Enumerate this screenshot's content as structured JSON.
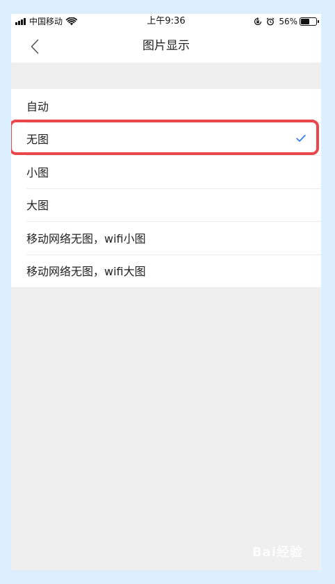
{
  "status_bar": {
    "carrier": "中国移动",
    "time": "上午9:36",
    "battery_percent": "56%",
    "battery_level": 0.56,
    "icons": [
      "signal-icon",
      "wifi-icon",
      "rotation-lock-icon",
      "alarm-icon",
      "battery-icon"
    ]
  },
  "nav": {
    "title": "图片显示",
    "back_icon": "chevron-left-icon"
  },
  "options": [
    {
      "label": "自动",
      "selected": false
    },
    {
      "label": "无图",
      "selected": true
    },
    {
      "label": "小图",
      "selected": false
    },
    {
      "label": "大图",
      "selected": false
    },
    {
      "label": "移动网络无图，wifi小图",
      "selected": false
    },
    {
      "label": "移动网络无图，wifi大图",
      "selected": false
    }
  ],
  "watermark": "Bai经验",
  "colors": {
    "page_background": "#dcefff",
    "screen_background": "#efeff0",
    "check_color": "#3a7de0",
    "highlight_border": "#e9474c"
  }
}
